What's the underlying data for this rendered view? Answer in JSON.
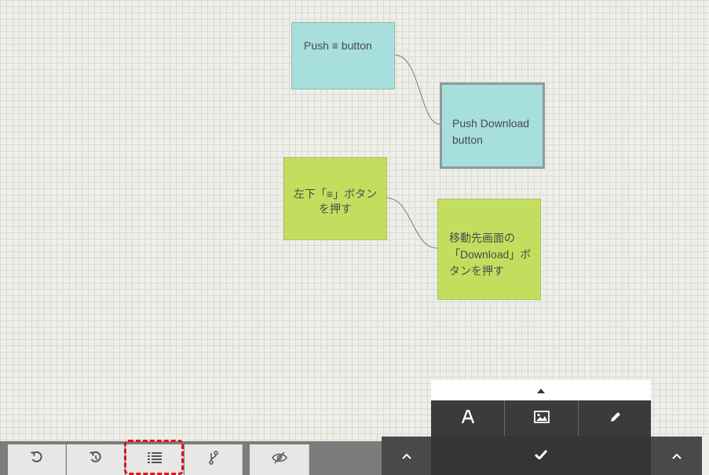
{
  "notes": [
    {
      "id": "push-menu",
      "color": "cyan",
      "text": "Push ≡ button"
    },
    {
      "id": "push-download",
      "color": "cyan",
      "text": "Push Download\nbutton"
    },
    {
      "id": "jp-menu",
      "color": "green",
      "text": "左下「≡」ボタン\nを押す"
    },
    {
      "id": "jp-download",
      "color": "green",
      "text": "移動先画面の\n「Download」ボ\nタンを押す"
    }
  ],
  "toolbar": {
    "undo_icon": "undo-icon",
    "history_icon": "history-icon",
    "list_icon": "list-icon",
    "branch_icon": "branch-icon",
    "hide_icon": "eye-slash-icon"
  },
  "popup": {
    "collapse_icon": "caret-up-icon",
    "text_icon": "text-icon",
    "image_icon": "image-icon",
    "pen_icon": "pencil-icon",
    "confirm_icon": "check-icon",
    "expand_icon": "chevron-up-icon"
  },
  "colors": {
    "note_cyan": "#a7dfdc",
    "note_green": "#c3de5e",
    "highlight": "#e0141a"
  }
}
